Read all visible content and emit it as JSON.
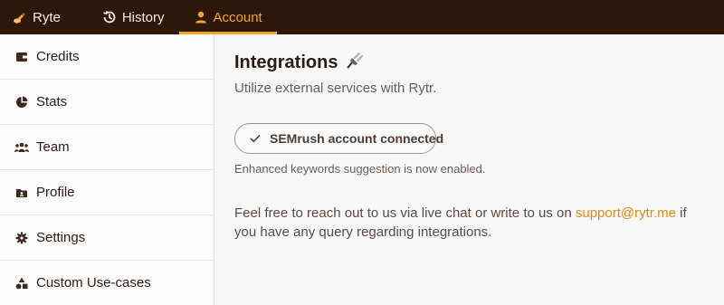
{
  "topnav": {
    "brand": "Ryte",
    "history": "History",
    "account": "Account"
  },
  "sidebar": {
    "items": [
      {
        "label": "Credits",
        "icon": "wallet-icon"
      },
      {
        "label": "Stats",
        "icon": "pie-chart-icon"
      },
      {
        "label": "Team",
        "icon": "team-icon"
      },
      {
        "label": "Profile",
        "icon": "folder-user-icon"
      },
      {
        "label": "Settings",
        "icon": "gear-icon"
      },
      {
        "label": "Custom Use-cases",
        "icon": "shapes-icon"
      }
    ]
  },
  "main": {
    "title": "Integrations",
    "title_icon": "plug-icon",
    "subtitle": "Utilize external services with Rytr.",
    "connected_label": "SEMrush account connected",
    "note": "Enhanced keywords suggestion is now enabled.",
    "help_before": "Feel free to reach out to us via live chat or write to us on",
    "help_email": "support@rytr.me",
    "help_after": "if you have any query regarding integrations."
  },
  "colors": {
    "topbar_bg": "#2d1809",
    "accent": "#f5a623",
    "link": "#e58a10"
  }
}
